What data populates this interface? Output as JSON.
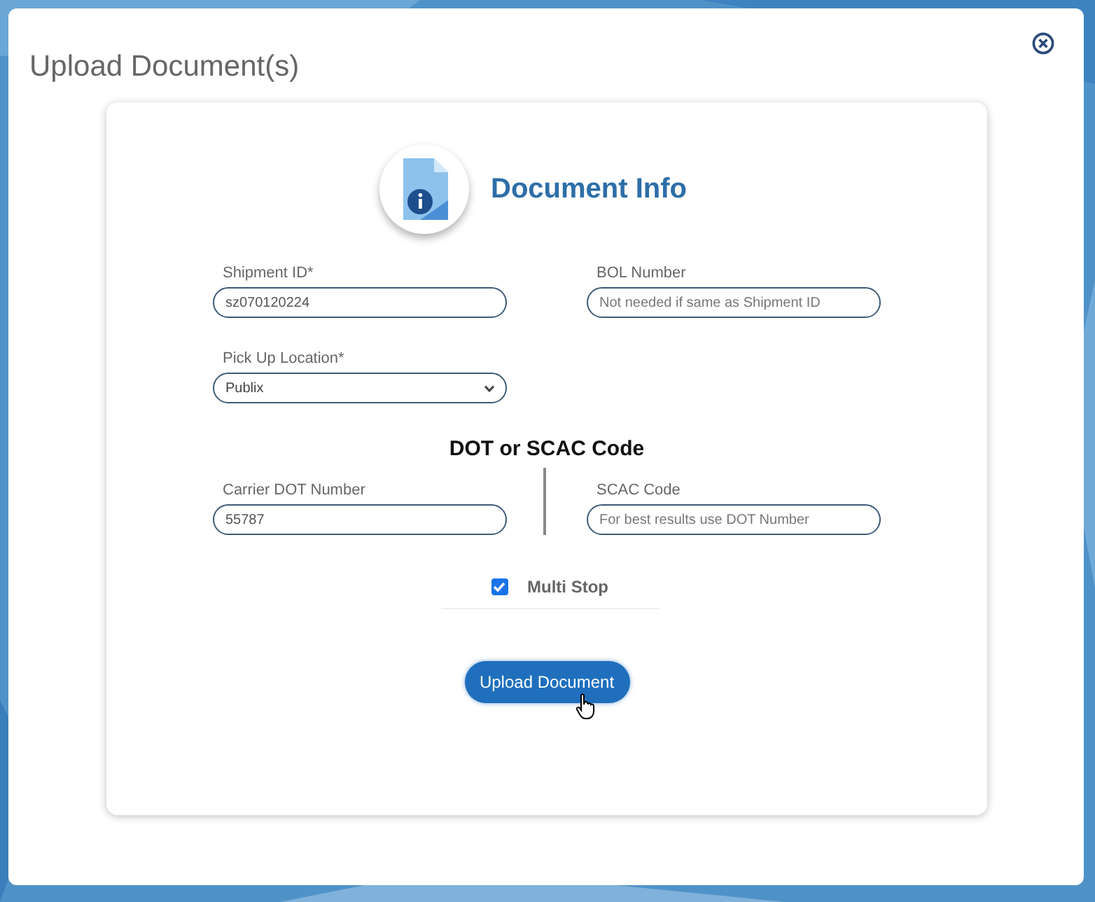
{
  "dialog": {
    "title": "Upload Document(s)"
  },
  "card": {
    "heading": "Document Info"
  },
  "rows": [
    {
      "fields": [
        {
          "kind": "text",
          "label": "Shipment ID*",
          "value": "sz070120224"
        },
        {
          "kind": "text",
          "label": "BOL Number",
          "placeholder": "Not needed if same as Shipment ID"
        }
      ]
    },
    {
      "fields": [
        {
          "kind": "select",
          "label": "Pick Up Location*",
          "value": "Publix"
        }
      ]
    }
  ],
  "carrier_section": {
    "heading": "DOT or SCAC Code",
    "fields": [
      {
        "kind": "text",
        "label": "Carrier DOT Number",
        "value": "55787"
      },
      {
        "kind": "text",
        "label": "SCAC Code",
        "placeholder": "For best results use DOT Number"
      }
    ]
  },
  "multi_stop": {
    "label": "Multi Stop",
    "checked": true
  },
  "submit_button": {
    "label": "Upload Document"
  }
}
